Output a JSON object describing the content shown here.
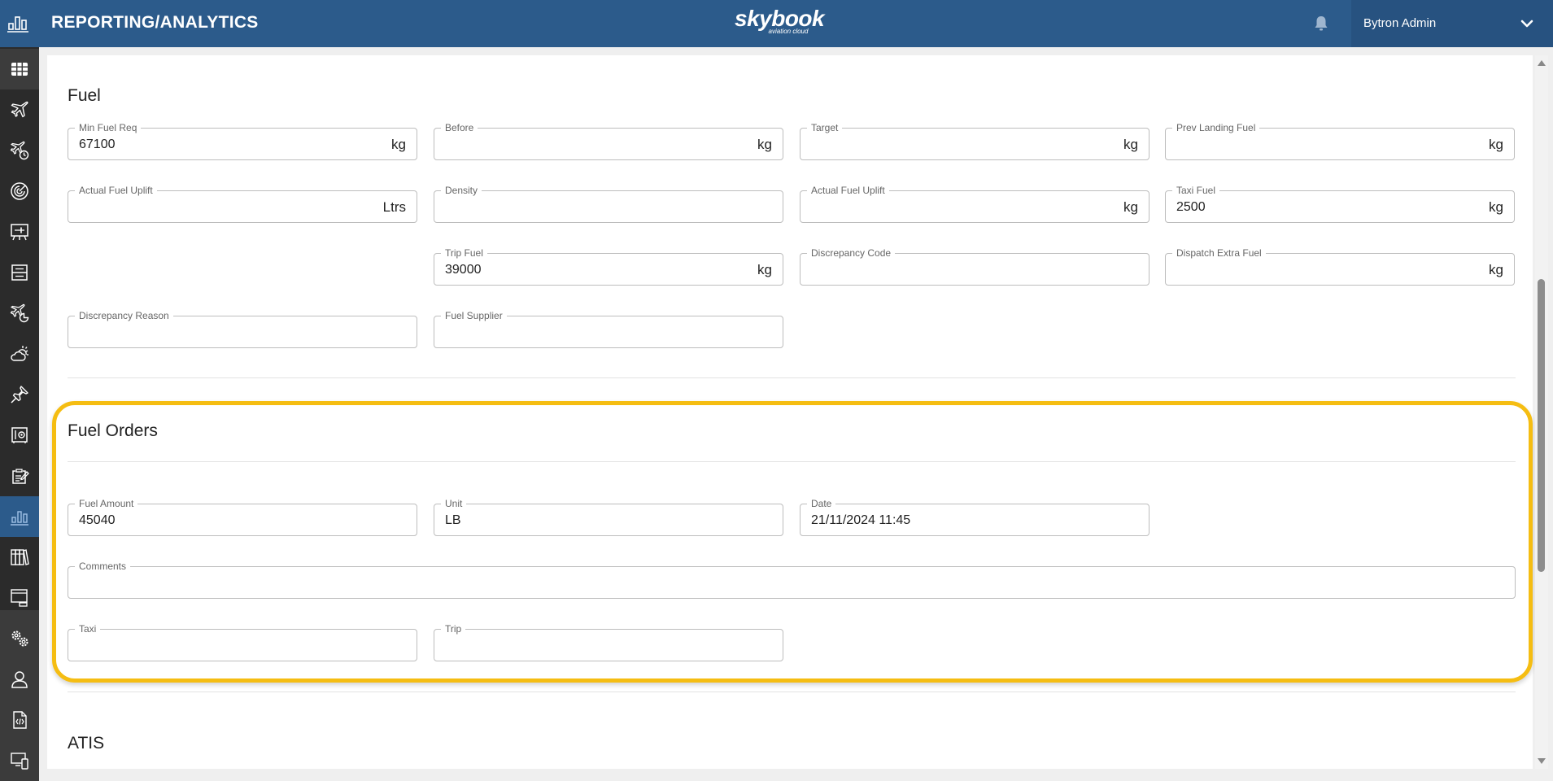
{
  "header": {
    "app_icon": "bar-chart-icon",
    "title": "REPORTING/ANALYTICS",
    "logo_brand": "skybook",
    "logo_tagline": "aviation cloud",
    "notification_icon": "bell-icon",
    "user_name": "Bytron Admin",
    "user_menu_icon": "chevron-down-icon"
  },
  "colors": {
    "header_bg": "#2c5b8b",
    "sidebar_bg": "#2b2b2b",
    "active_item_bg": "#2c5b8b",
    "highlight": "#f5bd12"
  },
  "sidebar": {
    "items": [
      {
        "icon": "grid-icon",
        "state": "top"
      },
      {
        "icon": "plane-icon"
      },
      {
        "icon": "plane-clock-icon"
      },
      {
        "icon": "radar-icon"
      },
      {
        "icon": "briefing-board-icon"
      },
      {
        "icon": "drawer-icon"
      },
      {
        "icon": "plane-schedule-icon"
      },
      {
        "icon": "weather-icon"
      },
      {
        "icon": "pin-icon"
      },
      {
        "icon": "safe-icon"
      },
      {
        "icon": "clipboard-edit-icon"
      },
      {
        "icon": "bar-chart-icon",
        "state": "active"
      },
      {
        "icon": "library-icon"
      },
      {
        "icon": "display-icon"
      },
      {
        "icon": "settings-gears-icon"
      },
      {
        "icon": "user-icon"
      },
      {
        "icon": "code-file-icon"
      },
      {
        "icon": "devices-icon"
      }
    ]
  },
  "fuel": {
    "title": "Fuel",
    "fields": [
      {
        "label": "Min Fuel Req",
        "value": "67100",
        "unit": "kg"
      },
      {
        "label": "Before",
        "value": "",
        "unit": "kg"
      },
      {
        "label": "Target",
        "value": "",
        "unit": "kg"
      },
      {
        "label": "Prev Landing Fuel",
        "value": "",
        "unit": "kg"
      },
      {
        "label": "Actual Fuel Uplift",
        "value": "",
        "unit": "Ltrs"
      },
      {
        "label": "Density",
        "value": "",
        "unit": ""
      },
      {
        "label": "Actual Fuel Uplift",
        "value": "",
        "unit": "kg"
      },
      {
        "label": "Taxi Fuel",
        "value": "2500",
        "unit": "kg"
      },
      {
        "label": "Trip Fuel",
        "value": "39000",
        "unit": "kg"
      },
      {
        "label": "Discrepancy Code",
        "value": "",
        "unit": ""
      },
      {
        "label": "Dispatch Extra Fuel",
        "value": "",
        "unit": "kg"
      },
      {
        "label": "Discrepancy Reason",
        "value": "",
        "unit": ""
      },
      {
        "label": "Fuel Supplier",
        "value": "",
        "unit": ""
      }
    ]
  },
  "fuel_orders": {
    "title": "Fuel Orders",
    "fields": [
      {
        "label": "Fuel Amount",
        "value": "45040"
      },
      {
        "label": "Unit",
        "value": "LB"
      },
      {
        "label": "Date",
        "value": "21/11/2024 11:45"
      },
      {
        "label": "Comments",
        "value": ""
      },
      {
        "label": "Taxi",
        "value": ""
      },
      {
        "label": "Trip",
        "value": ""
      }
    ]
  },
  "atis": {
    "title": "ATIS"
  }
}
